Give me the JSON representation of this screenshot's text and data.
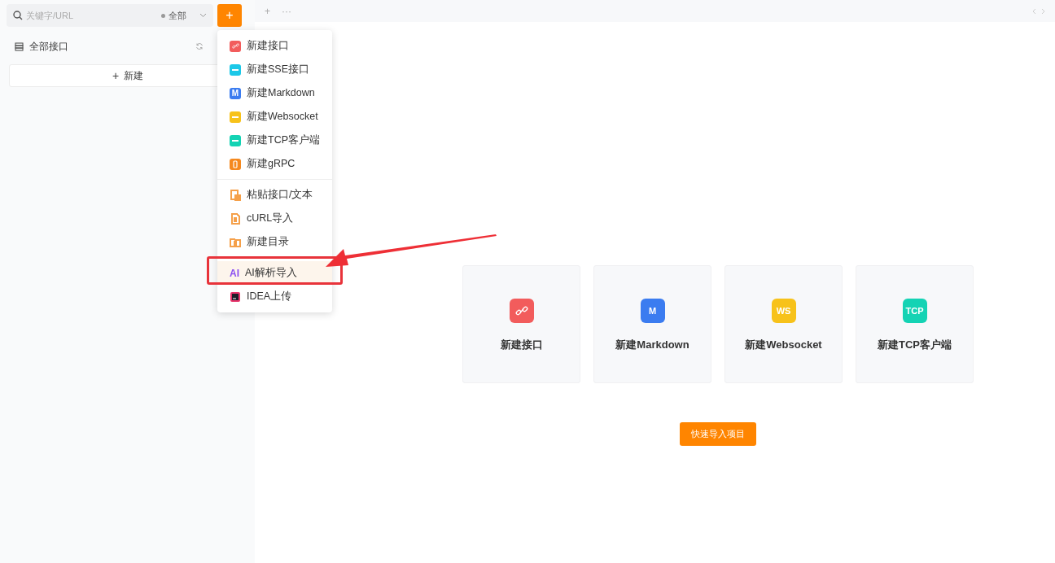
{
  "search": {
    "placeholder": "关键字/URL",
    "filter": "全部"
  },
  "add_button": "+",
  "sidebar": {
    "title": "全部接口",
    "new_button": {
      "glyph": "+",
      "label": "新建"
    }
  },
  "tabbar": {
    "add": "+",
    "more": "···"
  },
  "menu": {
    "sections": [
      [
        {
          "label": "新建接口",
          "kind": "link",
          "color": "#f25c5c",
          "selected": false
        },
        {
          "label": "新建SSE接口",
          "kind": "tile",
          "color": "#1cc8e8",
          "selected": false
        },
        {
          "label": "新建Markdown",
          "kind": "letters",
          "badge": "M",
          "color": "#3b7cf0",
          "selected": false
        },
        {
          "label": "新建Websocket",
          "kind": "tile",
          "color": "#f7c21a",
          "selected": false
        },
        {
          "label": "新建TCP客户端",
          "kind": "tile",
          "color": "#14d3b4",
          "selected": false
        },
        {
          "label": "新建gRPC",
          "kind": "phone",
          "color": "#f5891f",
          "selected": false
        }
      ],
      [
        {
          "label": "粘贴接口/文本",
          "kind": "clipboard",
          "color": "#f5a04a",
          "selected": false
        },
        {
          "label": "cURL导入",
          "kind": "file",
          "color": "#f5a04a",
          "selected": false
        },
        {
          "label": "新建目录",
          "kind": "folder",
          "color": "#f5a04a",
          "selected": false
        }
      ],
      [
        {
          "label": "AI解析导入",
          "kind": "wordmark",
          "badge": "AI",
          "color": "#8a4df0",
          "selected": true
        },
        {
          "label": "IDEA上传",
          "kind": "ide",
          "color": "#1e1e2a",
          "selected": false
        }
      ]
    ]
  },
  "cards": [
    {
      "label": "新建接口",
      "kind": "link",
      "color": "#f25c5c"
    },
    {
      "label": "新建Markdown",
      "kind": "letters",
      "badge": "M",
      "color": "#3b7cf0"
    },
    {
      "label": "新建Websocket",
      "kind": "letters",
      "badge": "WS",
      "color": "#f7c21a"
    },
    {
      "label": "新建TCP客户端",
      "kind": "letters",
      "badge": "TCP",
      "color": "#14d3b4"
    }
  ],
  "import_button": "快速导入项目"
}
